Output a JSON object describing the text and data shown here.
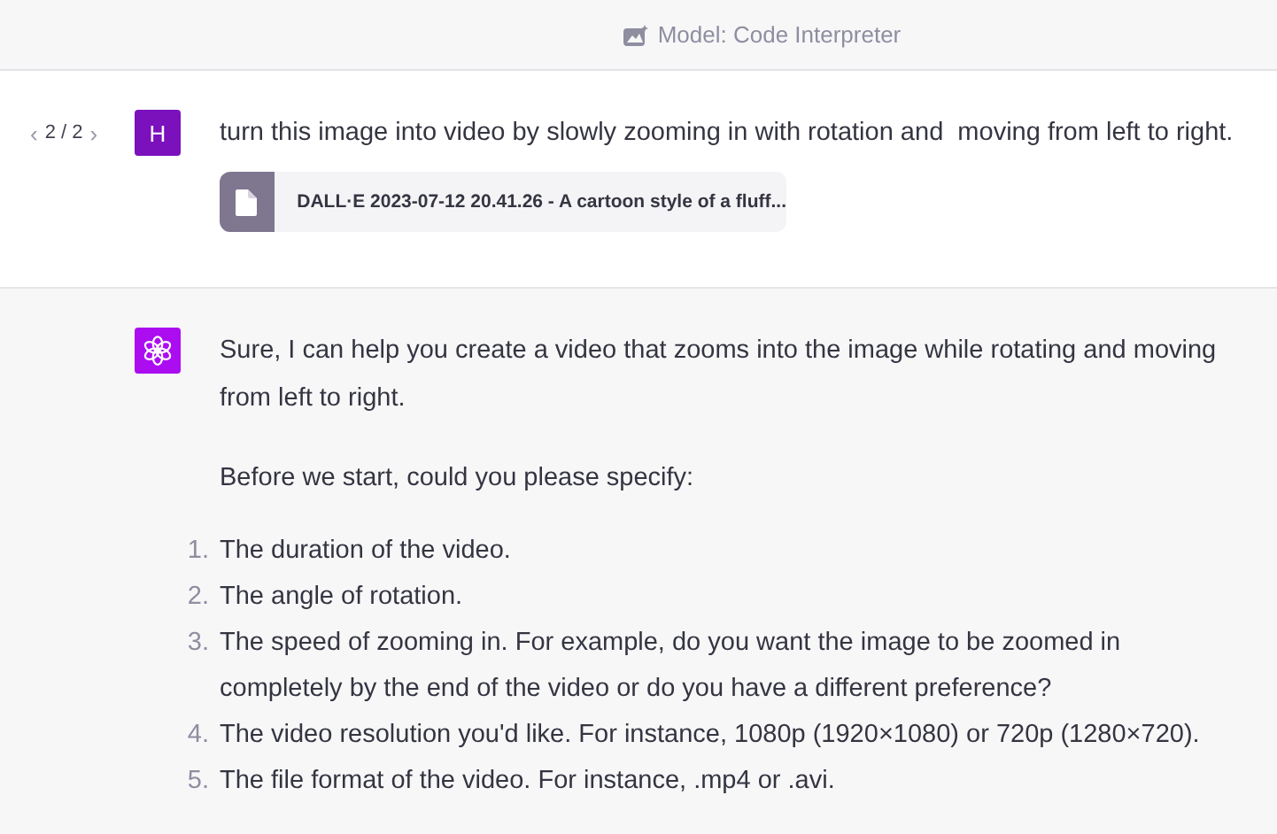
{
  "header": {
    "model_label": "Model: Code Interpreter"
  },
  "user_message": {
    "pager": {
      "prev": "‹",
      "position": "2 / 2",
      "next": "›"
    },
    "avatar_letter": "H",
    "text": "turn this image into video by slowly zooming in with rotation and  moving from left to right.",
    "attachment": {
      "file_name": "DALL·E 2023-07-12 20.41.26 - A cartoon style of a fluff..."
    }
  },
  "assistant_message": {
    "paragraphs": [
      "Sure, I can help you create a video that zooms into the image while rotating and moving from left to right.",
      "Before we start, could you please specify:"
    ],
    "list": [
      {
        "number": "1.",
        "text": "The duration of the video."
      },
      {
        "number": "2.",
        "text": "The angle of rotation."
      },
      {
        "number": "3.",
        "text": "The speed of zooming in. For example, do you want the image to be zoomed in completely by the end of the video or do you have a different preference?"
      },
      {
        "number": "4.",
        "text": "The video resolution you'd like. For instance, 1080p (1920×1080) or 720p (1280×720)."
      },
      {
        "number": "5.",
        "text": "The file format of the video. For instance, .mp4 or .avi."
      }
    ]
  }
}
